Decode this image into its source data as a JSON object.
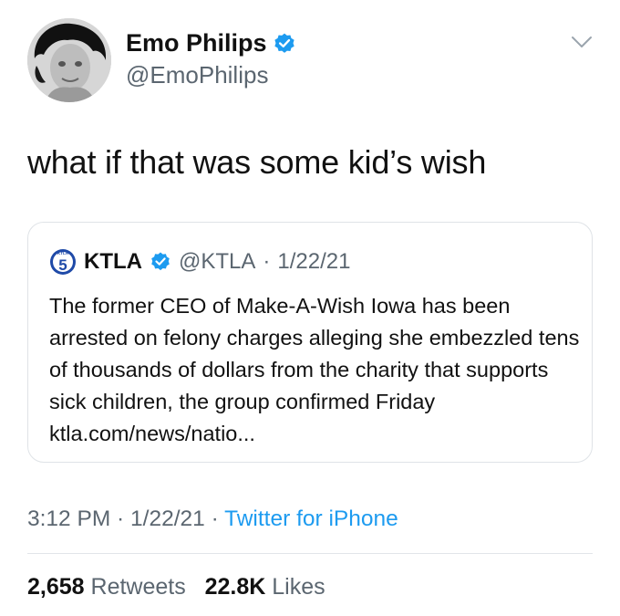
{
  "author": {
    "name": "Emo Philips",
    "handle": "@EmoPhilips",
    "avatar_icon": "profile-photo",
    "verified": true
  },
  "tweet": {
    "text": "what if that was some kid’s wish"
  },
  "quoted": {
    "logo_text": "5",
    "logo_small_text": "KTLA",
    "name": "KTLA",
    "handle": "@KTLA",
    "separator": "·",
    "date": "1/22/21",
    "body": "The former CEO of Make-A-Wish Iowa has been arrested on felony charges alleging she embezzled tens of thousands of dollars from the charity that supports sick children, the group confirmed Friday ktla.com/news/natio..."
  },
  "meta": {
    "time": "3:12 PM",
    "separator": " · ",
    "date": "1/22/21",
    "source": "Twitter for iPhone"
  },
  "stats": {
    "retweets_count": "2,658",
    "retweets_label": "Retweets",
    "likes_count": "22.8K",
    "likes_label": "Likes"
  },
  "colors": {
    "verified": "#1d9bf0",
    "link": "#1d9bf0",
    "secondary_text": "#5b6670"
  }
}
